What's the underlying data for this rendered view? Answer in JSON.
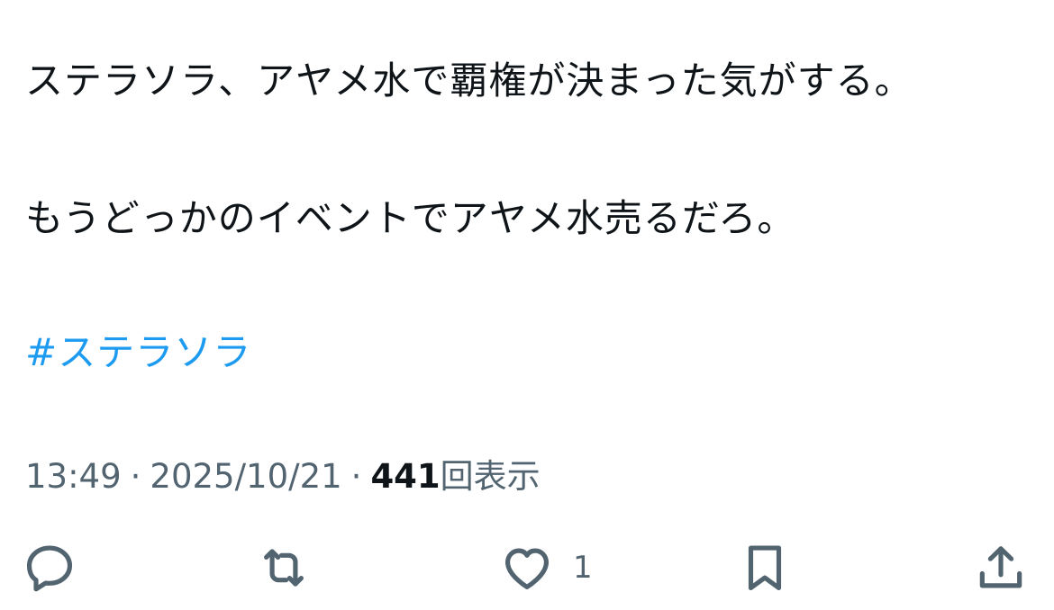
{
  "tweet": {
    "line1": "ステラソラ、アヤメ水で覇権が決まった気がする。",
    "line2": "もうどっかのイベントでアヤメ水売るだろ。",
    "hashtag": "#ステラソラ"
  },
  "meta": {
    "time": "13:49",
    "separator1": "·",
    "date": "2025/10/21",
    "separator2": "·",
    "view_count": "441",
    "view_label": "回表示"
  },
  "actions": {
    "reply_icon": "reply-icon",
    "retweet_icon": "retweet-icon",
    "like_icon": "heart-icon",
    "like_count": "1",
    "bookmark_icon": "bookmark-icon",
    "share_icon": "share-icon"
  },
  "colors": {
    "text": "#0f1419",
    "secondary": "#536471",
    "link": "#1d9bf0",
    "background": "#ffffff"
  }
}
